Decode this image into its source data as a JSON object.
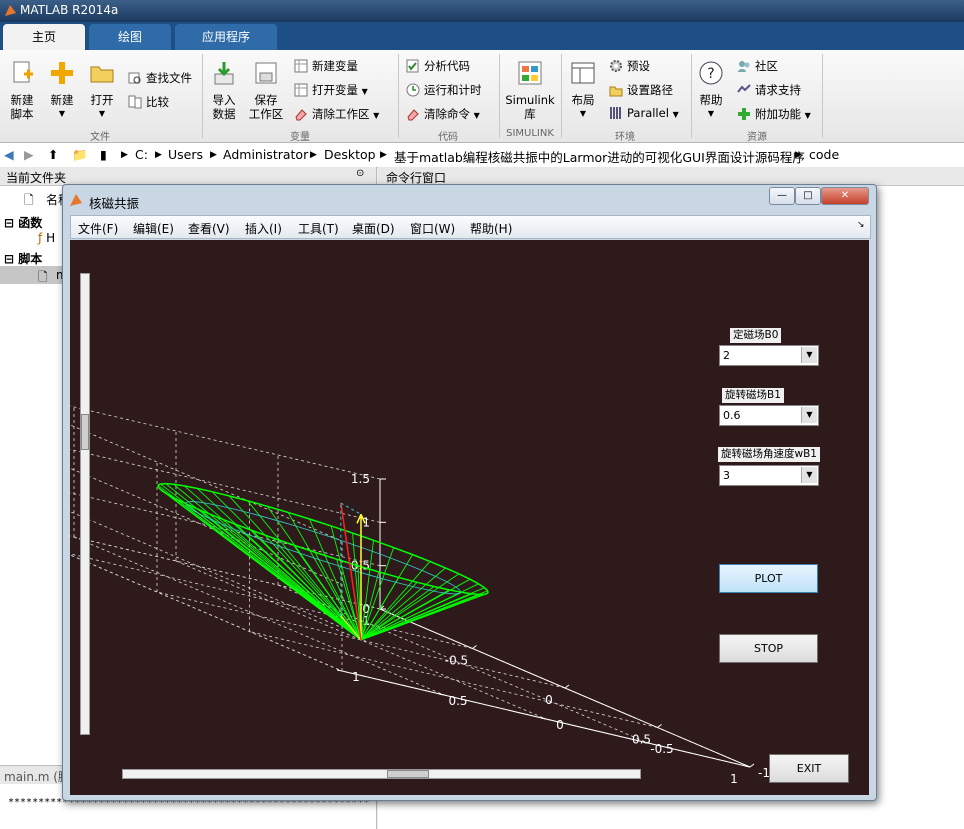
{
  "app": {
    "title": "MATLAB R2014a"
  },
  "tabs": [
    "主页",
    "绘图",
    "应用程序"
  ],
  "ribbon": {
    "file": {
      "new_script": "新建\n脚本",
      "new": "新建",
      "open": "打开",
      "find_files": "查找文件",
      "compare": "比较",
      "section": "文件"
    },
    "variable": {
      "import": "导入\n数据",
      "save_ws": "保存\n工作区",
      "new_var": "新建变量",
      "open_var": "打开变量",
      "clear_ws": "清除工作区",
      "section": "变量"
    },
    "code": {
      "analyze": "分析代码",
      "run_time": "运行和计时",
      "clear_cmd": "清除命令",
      "section": "代码"
    },
    "simulink": {
      "lib": "Simulink\n库",
      "section": "SIMULINK"
    },
    "env": {
      "layout": "布局",
      "prefs": "预设",
      "set_path": "设置路径",
      "parallel": "Parallel",
      "section": "环境"
    },
    "resources": {
      "help": "帮助",
      "community": "社区",
      "support": "请求支持",
      "addons": "附加功能",
      "section": "资源"
    }
  },
  "address": {
    "path": [
      "C:",
      "Users",
      "Administrator",
      "Desktop",
      "基于matlab编程核磁共振中的Larmor进动的可视化GUI界面设计源码程序",
      "code"
    ]
  },
  "left_panel": {
    "title": "当前文件夹",
    "name_col": "名称",
    "group_functions": "函数",
    "group_scripts": "脚本",
    "file_h": "H",
    "file_m": "m",
    "footer_file": "main.m (脚",
    "stars": "************************************************************"
  },
  "command_window": {
    "title": "命令行窗口"
  },
  "figure": {
    "title": "核磁共振",
    "menu": [
      "文件(F)",
      "编辑(E)",
      "查看(V)",
      "插入(I)",
      "工具(T)",
      "桌面(D)",
      "窗口(W)",
      "帮助(H)"
    ],
    "controls": {
      "b0_label": "定磁场B0",
      "b0_value": "2",
      "b1_label": "旋转磁场B1",
      "b1_value": "0.6",
      "wb1_label": "旋转磁场角速度wB1",
      "wb1_value": "3",
      "plot": "PLOT",
      "stop": "STOP",
      "exit": "EXIT"
    },
    "axes": {
      "z_ticks": [
        "0",
        "0.5",
        "1",
        "1.5"
      ],
      "x_ticks": [
        "-1",
        "-0.5",
        "0",
        "0.5",
        "1"
      ],
      "y_ticks": [
        "-1",
        "-0.5",
        "0",
        "0.5",
        "1"
      ]
    },
    "colors": {
      "cone": "#00ff00",
      "red_vec": "#ff2020",
      "yellow_vec": "#ffff33",
      "cyan": "#33cccc",
      "bg": "#2f1a1b"
    }
  }
}
